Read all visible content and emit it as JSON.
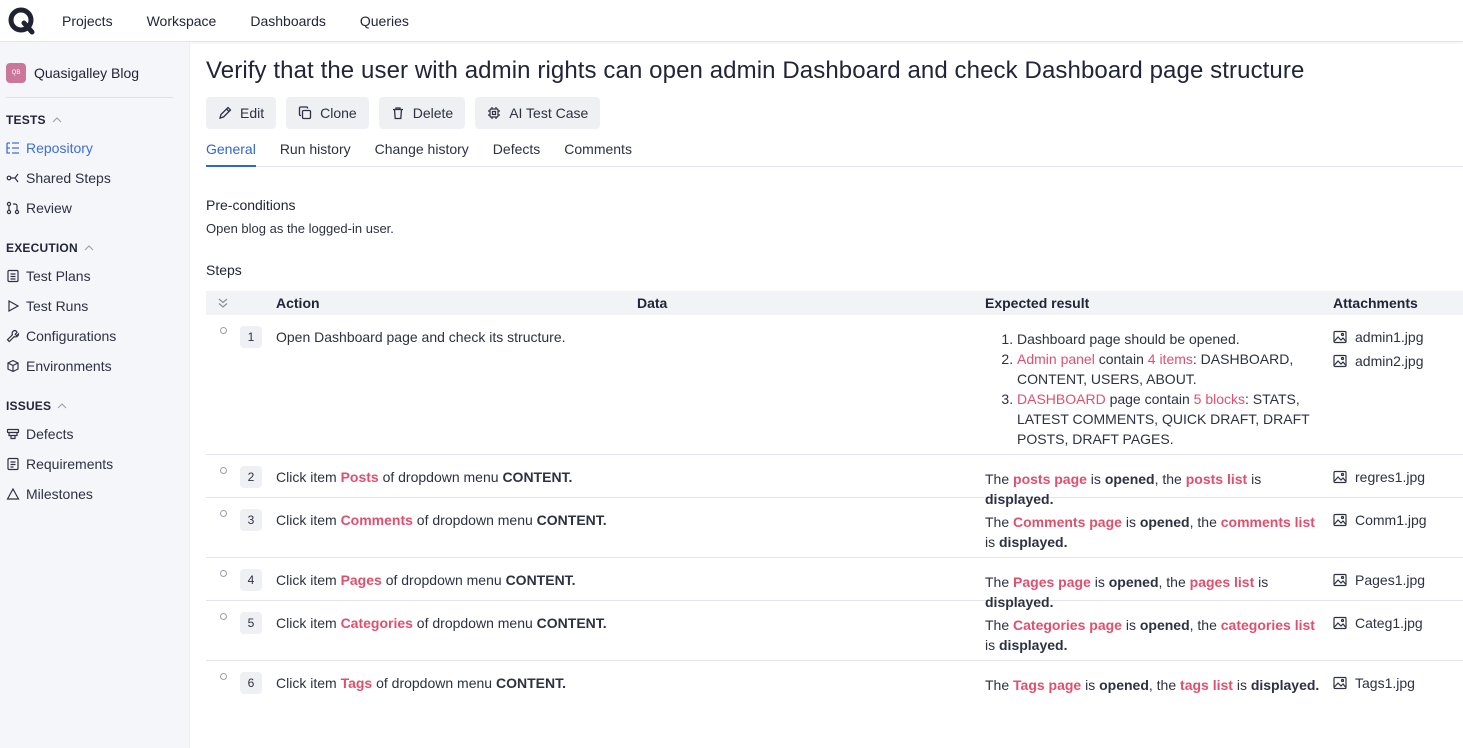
{
  "nav": {
    "logo": "Q",
    "items": [
      "Projects",
      "Workspace",
      "Dashboards",
      "Queries"
    ]
  },
  "sidebar": {
    "project": {
      "badge": "QB",
      "name": "Quasigalley Blog"
    },
    "sections": [
      {
        "title": "TESTS",
        "items": [
          "Repository",
          "Shared Steps",
          "Review"
        ]
      },
      {
        "title": "EXECUTION",
        "items": [
          "Test Plans",
          "Test Runs",
          "Configurations",
          "Environments"
        ]
      },
      {
        "title": "ISSUES",
        "items": [
          "Defects",
          "Requirements",
          "Milestones"
        ]
      }
    ],
    "active_item": "Repository"
  },
  "page": {
    "title": "Verify that the user with admin rights can open admin Dashboard and check Dashboard page structure",
    "actions": [
      "Edit",
      "Clone",
      "Delete",
      "AI Test Case"
    ],
    "tabs": [
      "General",
      "Run history",
      "Change history",
      "Defects",
      "Comments"
    ],
    "active_tab": "General",
    "preconditions_label": "Pre-conditions",
    "preconditions_text": "Open blog as the logged-in user.",
    "steps_label": "Steps"
  },
  "steps_table": {
    "headers": {
      "action": "Action",
      "data": "Data",
      "expected": "Expected result",
      "attachments": "Attachments"
    },
    "rows": [
      {
        "num": "1",
        "action": "Open Dashboard page and check its structure.",
        "expected_list": [
          "Dashboard page should be opened.",
          "Admin panel contain 4 items: DASHBOARD, CONTENT, USERS, ABOUT.",
          "DASHBOARD page contain 5 blocks: STATS, LATEST COMMENTS, QUICK DRAFT, DRAFT POSTS, DRAFT PAGES."
        ],
        "attachments": [
          "admin1.jpg",
          "admin2.jpg"
        ]
      },
      {
        "num": "2",
        "action_pre": "Click item ",
        "action_item": "Posts",
        "action_post": " of dropdown menu ",
        "action_menu": "CONTENT.",
        "exp_page": "posts page",
        "exp_list": "posts list",
        "attachments": [
          "regres1.jpg"
        ]
      },
      {
        "num": "3",
        "action_pre": "Click item ",
        "action_item": "Comments",
        "action_post": " of dropdown menu ",
        "action_menu": "CONTENT.",
        "exp_page": "Comments page",
        "exp_list": "comments list",
        "attachments": [
          "Comm1.jpg"
        ]
      },
      {
        "num": "4",
        "action_pre": "Click item ",
        "action_item": "Pages",
        "action_post": " of dropdown menu ",
        "action_menu": "CONTENT.",
        "exp_page": "Pages page",
        "exp_list": "pages list",
        "attachments": [
          "Pages1.jpg"
        ]
      },
      {
        "num": "5",
        "action_pre": "Click item ",
        "action_item": "Categories",
        "action_post": " of dropdown menu ",
        "action_menu": "CONTENT.",
        "exp_page": "Categories page",
        "exp_list": "categories list",
        "attachments": [
          "Categ1.jpg"
        ]
      },
      {
        "num": "6",
        "action_pre": "Click item ",
        "action_item": "Tags",
        "action_post": " of dropdown menu ",
        "action_menu": "CONTENT.",
        "exp_page": "Tags page",
        "exp_list": "tags list",
        "attachments": [
          "Tags1.jpg"
        ]
      }
    ],
    "expected_words": {
      "the": "The",
      "is": " is ",
      "opened": "opened",
      "comma_the": ", the ",
      "displayed": "displayed."
    }
  },
  "row1_parts": {
    "admin_panel": "Admin panel",
    "contain": " contain ",
    "four_items": "4 items",
    "items_list": ": DASHBOARD, CONTENT, USERS, ABOUT.",
    "dashboard": "DASHBOARD",
    "page_contain": " page contain ",
    "five_blocks": "5 blocks",
    "blocks_list": ": STATS, LATEST COMMENTS, QUICK DRAFT, DRAFT POSTS, DRAFT PAGES."
  },
  "colors": {
    "accent": "#2f66d0",
    "highlight": "#e0506d",
    "project_badge": "#c9789b"
  },
  "icons": {
    "logo": "q-logo-icon",
    "edit": "pencil-icon",
    "clone": "copy-icon",
    "delete": "trash-icon",
    "ai": "chip-icon",
    "attachment": "image-icon"
  }
}
